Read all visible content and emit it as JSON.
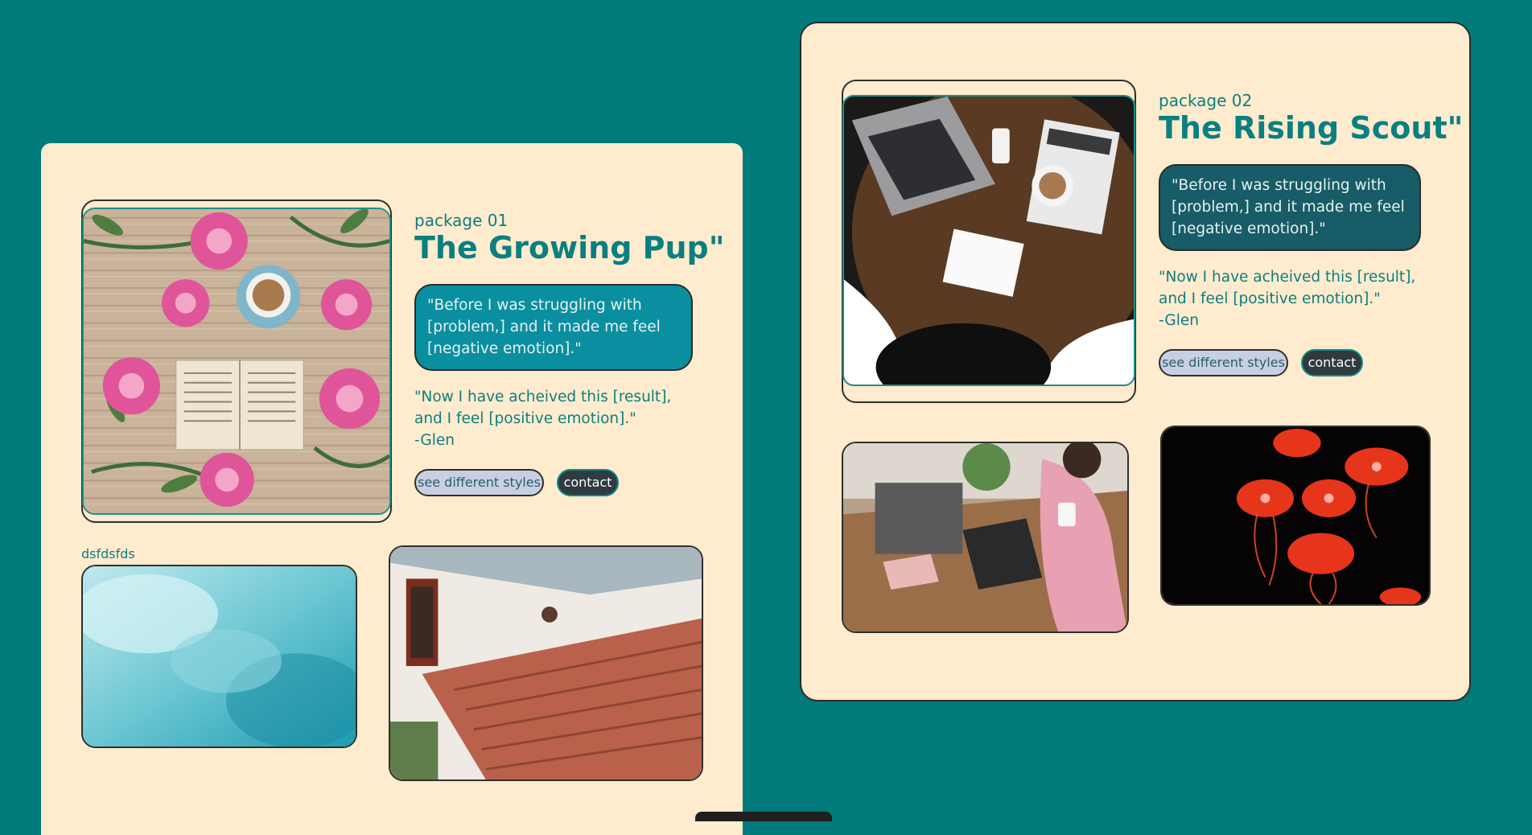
{
  "packages": [
    {
      "label": "package 01",
      "title": "The Growing Pup\"",
      "bubble_text": "\"Before I was struggling with [problem,] and it made me feel [negative emotion].\"",
      "quote_text": "\"Now I have acheived this [result], and I feel [positive emotion].\"",
      "author": "-Glen",
      "styles_button": "see different styles",
      "contact_button": "contact",
      "bubble_color": "#0a8fa0",
      "gallery_caption": "dsfdsfds"
    },
    {
      "label": "package 02",
      "title": "The Rising Scout\"",
      "bubble_text": "\"Before I was struggling with [problem,] and it made me feel [negative emotion].\"",
      "quote_text": "\"Now I have acheived this [result], and I feel [positive emotion].\"",
      "author": "-Glen",
      "styles_button": "see different styles",
      "contact_button": "contact",
      "bubble_color": "#175c66"
    }
  ],
  "colors": {
    "page_background": "#017a7c",
    "card_background": "#ffebcd",
    "accent_text": "#0b7f80"
  }
}
